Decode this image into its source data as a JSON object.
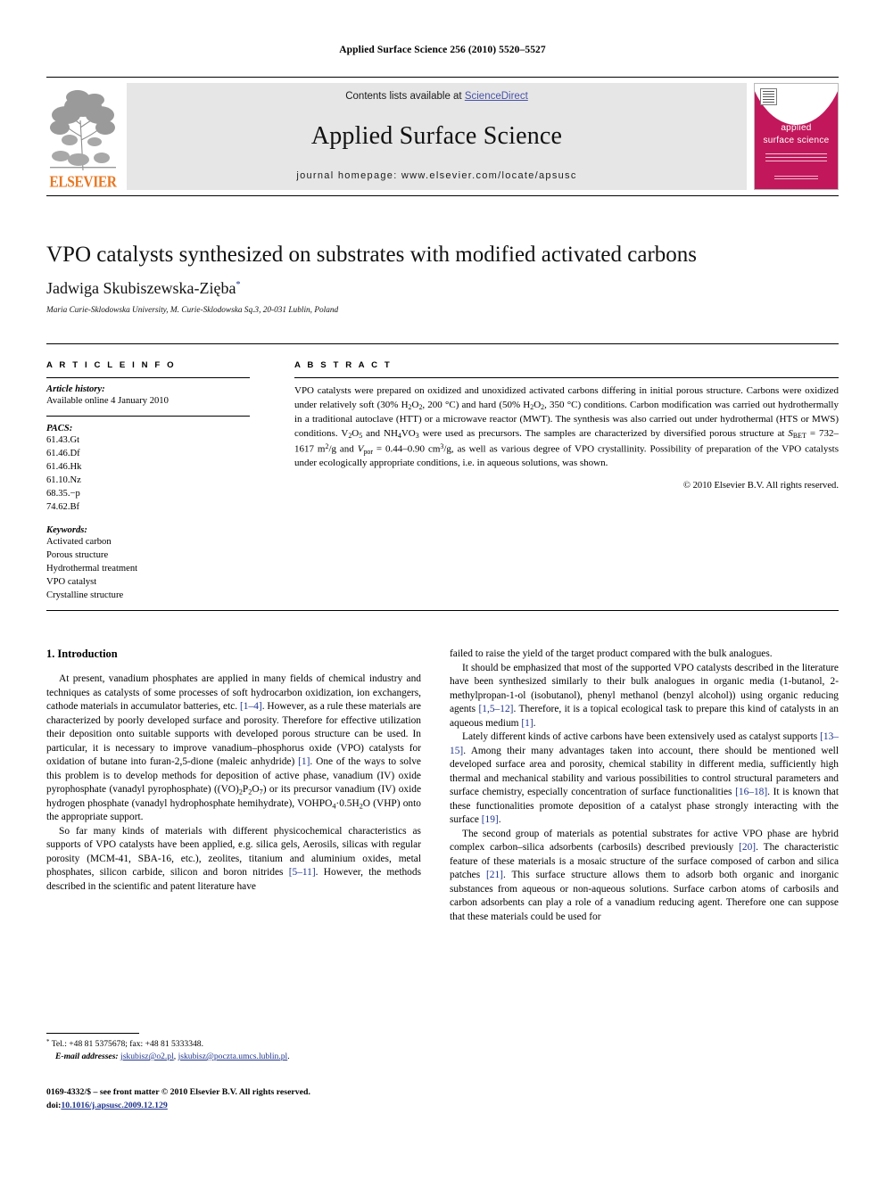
{
  "running_head": "Applied Surface Science 256 (2010) 5520–5527",
  "banner": {
    "publisher": "ELSEVIER",
    "contents_prefix": "Contents lists available at ",
    "contents_link": "ScienceDirect",
    "journal_name": "Applied Surface Science",
    "homepage": "journal homepage: www.elsevier.com/locate/apsusc",
    "cover_title_line1": "applied",
    "cover_title_line2": "surface science",
    "link_color": "#4752a8",
    "cover_color": "#C2185B",
    "publisher_color": "#E87722"
  },
  "article": {
    "title": "VPO catalysts synthesized on substrates with modified activated carbons",
    "author": "Jadwiga Skubiszewska-Zięba",
    "author_marker": "*",
    "affiliation": "Maria Curie-Sklodowska University, M. Curie-Sklodowska Sq.3, 20-031 Lublin, Poland"
  },
  "info": {
    "heading": "A R T I C L E   I N F O",
    "history_label": "Article history:",
    "history_value": "Available online 4 January 2010",
    "pacs_label": "PACS:",
    "pacs": [
      "61.43.Gt",
      "61.46.Df",
      "61.46.Hk",
      "61.10.Nz",
      "68.35.−p",
      "74.62.Bf"
    ],
    "keywords_label": "Keywords:",
    "keywords": [
      "Activated carbon",
      "Porous structure",
      "Hydrothermal treatment",
      "VPO catalyst",
      "Crystalline structure"
    ]
  },
  "abstract": {
    "heading": "A B S T R A C T",
    "rights": "© 2010 Elsevier B.V. All rights reserved."
  },
  "sections": {
    "introduction_heading": "1. Introduction"
  },
  "footnote": {
    "marker": "*",
    "tel": "Tel.: +48 81 5375678; fax: +48 81 5333348.",
    "email_label": "E-mail addresses:",
    "email1": "jskubisz@o2.pl",
    "email2": "jskubisz@poczta.umcs.lublin.pl",
    "email_sep": ", ",
    "email_end": "."
  },
  "colophon": {
    "issn_line": "0169-4332/$ – see front matter © 2010 Elsevier B.V. All rights reserved.",
    "doi_label": "doi:",
    "doi_value": "10.1016/j.apsusc.2009.12.129"
  }
}
